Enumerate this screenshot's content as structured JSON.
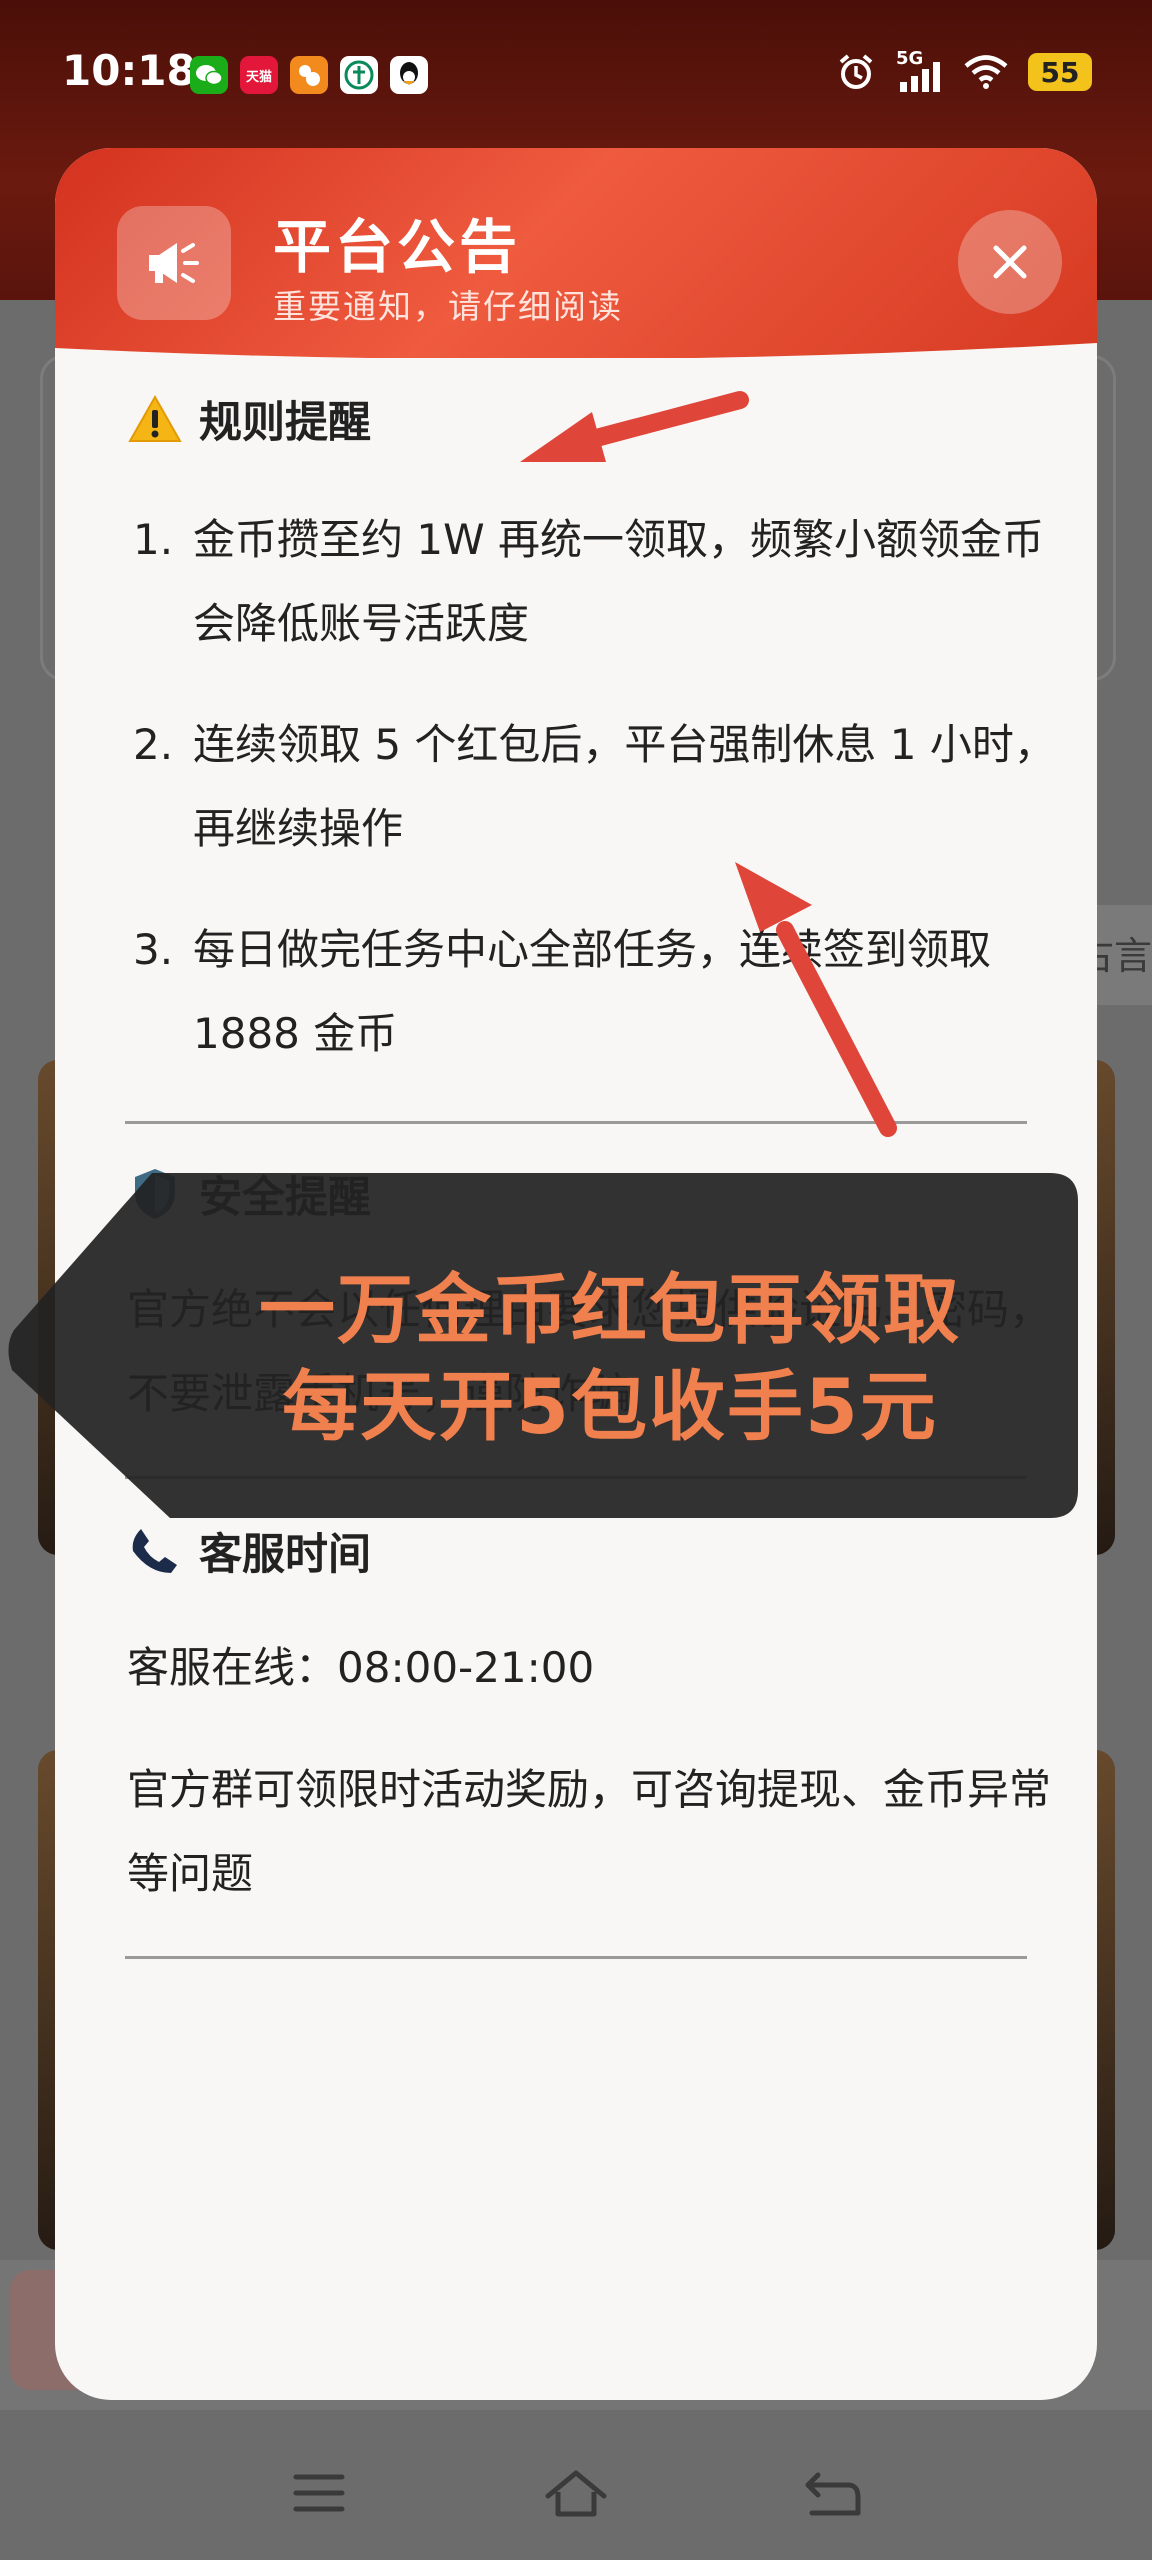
{
  "status_bar": {
    "time": "10:18",
    "network": "5G",
    "battery": "55",
    "app_icons": [
      "wechat-icon",
      "tmall-icon",
      "app-icon",
      "bank-icon",
      "qq-icon"
    ],
    "tmall_label": "天猫"
  },
  "background": {
    "chip_text": "古言"
  },
  "modal": {
    "title": "平台公告",
    "subtitle": "重要通知，请仔细阅读",
    "rules": {
      "title": "规则提醒",
      "items": [
        {
          "num": "1.",
          "text": "金币攒至约 1W 再统一领取，频繁小额领金币会降低账号活跃度"
        },
        {
          "num": "2.",
          "text": "连续领取 5 个红包后，平台强制休息 1 小时，再继续操作"
        },
        {
          "num": "3.",
          "text": "每日做完任务中心全部任务，连续签到领取 1888 金币"
        }
      ]
    },
    "security": {
      "title": "安全提醒",
      "text": "官方绝不会以任何理由要求您提供验证码、密码，不要泄露手机号，谨防诈骗"
    },
    "service": {
      "title": "客服时间",
      "hours": "客服在线：08:00-21:00",
      "group": "官方群可领限时活动奖励，可咨询提现、金币异常等问题"
    }
  },
  "overlay": {
    "line1": "一万金币红包再领取",
    "line2": "每天开5包收手5元"
  },
  "colors": {
    "header_red": "#d3321f",
    "overlay_text": "#f0804e",
    "arrow_red": "#e0453a"
  }
}
